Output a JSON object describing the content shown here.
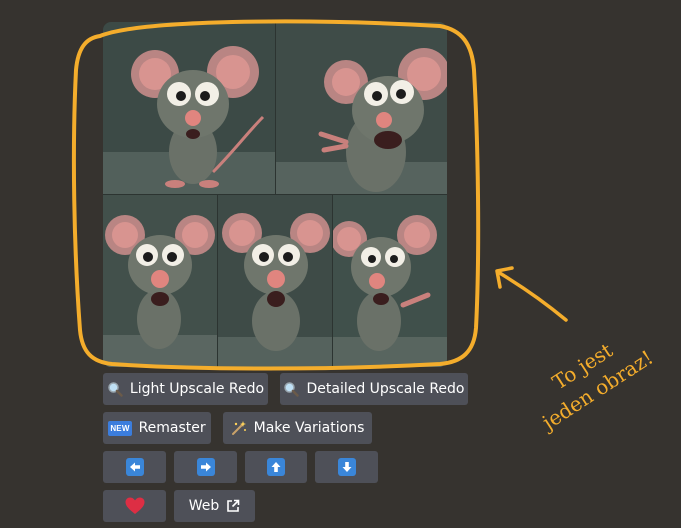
{
  "image": {
    "alt": "Four cartoon rat images in a 2x2 grid",
    "highlight_color": "#f4ad2c"
  },
  "buttons": {
    "light_upscale_redo": "Light Upscale Redo",
    "detailed_upscale_redo": "Detailed Upscale Redo",
    "remaster": "Remaster",
    "new_badge": "NEW",
    "make_variations": "Make Variations",
    "web": "Web"
  },
  "annotation": {
    "line1": "To jest",
    "line2": "jeden obraz!"
  },
  "colors": {
    "background": "#36332f",
    "button": "#4e5058",
    "accent": "#f4ad2c",
    "arrow_button": "#3a86d9",
    "heart": "#dd2e44"
  },
  "icons": [
    "magnifier-icon",
    "sparkles-icon",
    "arrow-left-icon",
    "arrow-right-icon",
    "arrow-up-icon",
    "arrow-down-icon",
    "heart-icon",
    "external-link-icon"
  ]
}
